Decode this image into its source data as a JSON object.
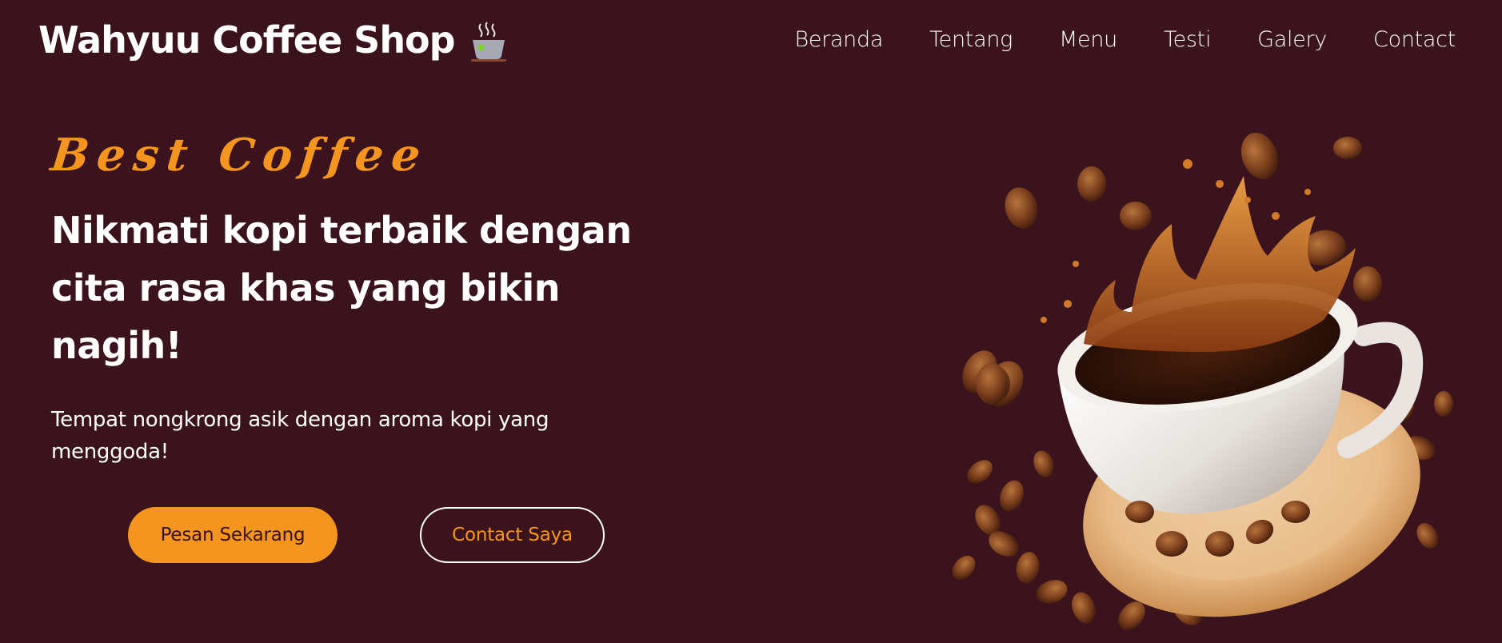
{
  "header": {
    "brand": "Wahyuu Coffee Shop",
    "brand_icon": "hot-tea-cup-icon",
    "nav": [
      {
        "label": "Beranda"
      },
      {
        "label": "Tentang"
      },
      {
        "label": "Menu"
      },
      {
        "label": "Testi"
      },
      {
        "label": "Galery"
      },
      {
        "label": "Contact"
      }
    ]
  },
  "hero": {
    "eyebrow": "Best Coffee",
    "headline": "Nikmati kopi terbaik dengan cita rasa khas yang bikin nagih!",
    "tagline": "Tempat nongkrong asik dengan aroma kopi yang menggoda!",
    "primary_button": "Pesan Sekarang",
    "secondary_button": "Contact Saya",
    "image": "coffee-cup-splash-with-beans"
  },
  "colors": {
    "background": "#3a131c",
    "accent": "#f3951f",
    "text": "#ffffff"
  }
}
